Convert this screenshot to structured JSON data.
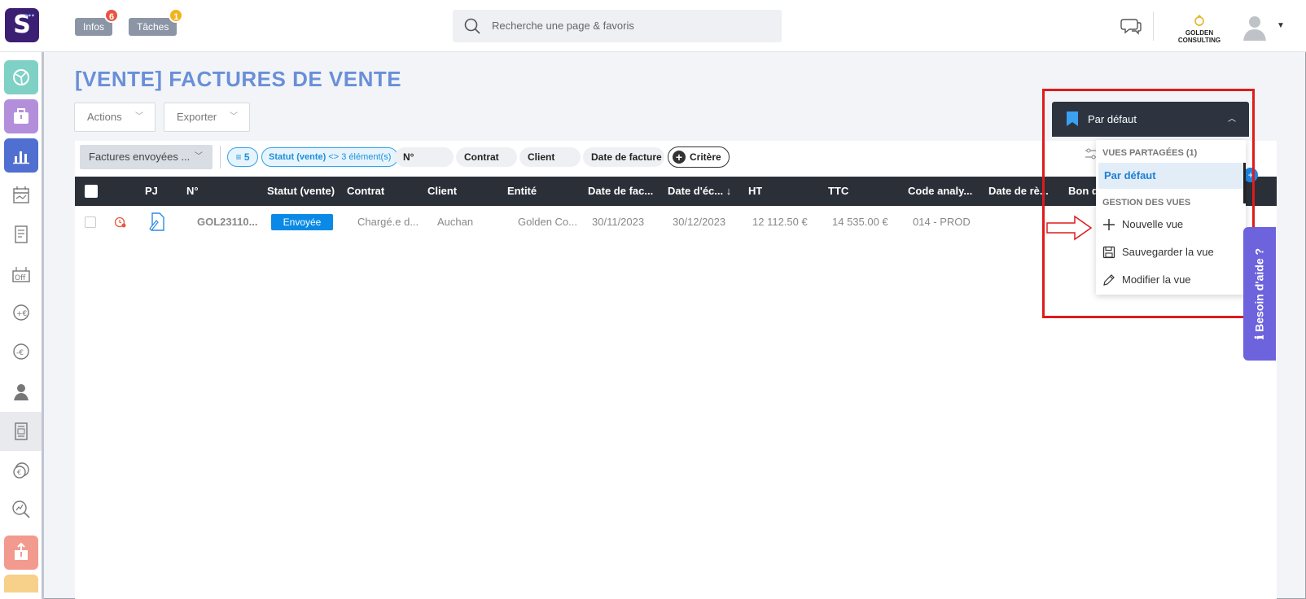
{
  "brand": {
    "logo_letter": "S"
  },
  "header": {
    "infos": {
      "label": "Infos",
      "badge": "6",
      "badge_color": "#e8563f"
    },
    "taches": {
      "label": "Tâches",
      "badge": "1",
      "badge_color": "#f2b31c"
    },
    "search_placeholder": "Recherche une page & favoris",
    "company": "GOLDEN CONSULTING"
  },
  "sidebar": {
    "items": [
      "map-icon",
      "briefcase-icon",
      "chart-icon",
      "calendar-icon",
      "receipt-icon",
      "off-icon",
      "euro-plus-icon",
      "euro-minus-icon",
      "user-icon",
      "invoice-icon",
      "coins-icon",
      "analytics-icon",
      "export-icon"
    ],
    "colors": [
      "#7fd1c6",
      "#b38fdb",
      "#4f6fd1",
      "#f2a66f"
    ]
  },
  "page": {
    "title": "[VENTE] FACTURES DE VENTE",
    "actions_label": "Actions",
    "export_label": "Exporter"
  },
  "filters": {
    "saved": "Factures envoyées ...",
    "count": "5",
    "status_chip_bold": "Statut (vente)",
    "status_chip_rest": " <> 3 élément(s)",
    "chips": [
      "N°",
      "Contrat",
      "Client",
      "Date de facture"
    ],
    "criteria_label": "Critère"
  },
  "table": {
    "columns": [
      "PJ",
      "N°",
      "Statut (vente)",
      "Contrat",
      "Client",
      "Entité",
      "Date de fac...",
      "Date d'éc... ↓",
      "HT",
      "TTC",
      "Code analy...",
      "Date de rè...",
      "Bon d"
    ],
    "rows": [
      {
        "number": "GOL23110...",
        "status": "Envoyée",
        "contract": "Chargé.e d...",
        "client": "Auchan",
        "entity": "Golden Co...",
        "invoice_date": "30/11/2023",
        "due_date": "30/12/2023",
        "ht": "12 112.50 €",
        "ttc": "14 535.00 €",
        "code": "014 - PROD"
      }
    ]
  },
  "views": {
    "current": "Par défaut",
    "shared_header": "VUES PARTAGÉES (1)",
    "selected": "Par défaut",
    "manage_header": "GESTION DES VUES",
    "new_view": "Nouvelle vue",
    "save_view": "Sauvegarder la vue",
    "edit_view": "Modifier la vue"
  },
  "help": {
    "label": "Besoin d'aide ?",
    "color": "#6d63dd"
  },
  "annotation_color": "#e01b1b"
}
